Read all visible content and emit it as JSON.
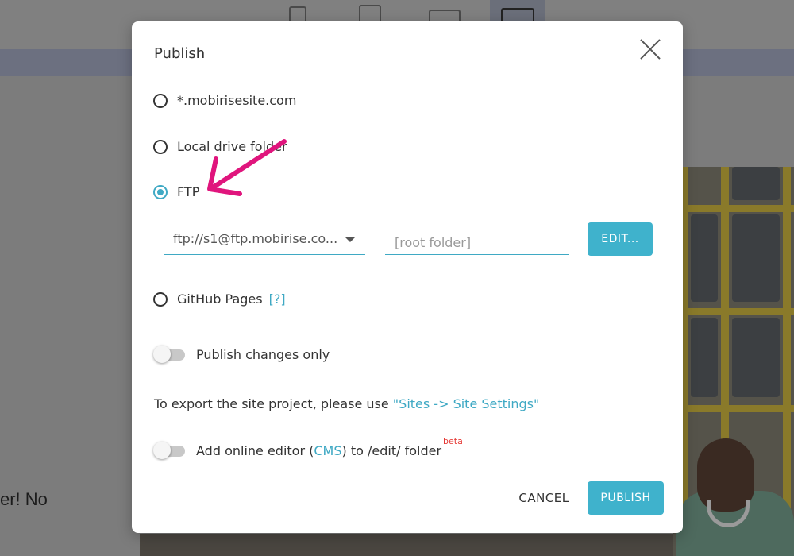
{
  "background": {
    "page_text": "er! No"
  },
  "modal": {
    "title": "Publish",
    "options": [
      {
        "label": "*.mobirisesite.com",
        "selected": false
      },
      {
        "label": "Local drive folder",
        "selected": false
      },
      {
        "label": "FTP",
        "selected": true
      },
      {
        "label": "GitHub Pages",
        "selected": false
      }
    ],
    "ftp": {
      "server_value": "ftp://s1@ftp.mobirise.co...",
      "root_placeholder": "[root folder]",
      "edit_label": "EDIT..."
    },
    "github_help": "[?]",
    "publish_changes_only": {
      "label": "Publish changes only",
      "on": false
    },
    "export_note": {
      "text": "To export the site project, please use ",
      "link": "\"Sites -> Site Settings\""
    },
    "cms": {
      "prefix": "Add online editor (",
      "link": "CMS",
      "suffix": ") to /edit/ folder",
      "badge": "beta",
      "on": false
    },
    "cancel_label": "CANCEL",
    "publish_label": "PUBLISH"
  },
  "colors": {
    "accent": "#3fb2cc",
    "annotation_arrow": "#e0157d",
    "beta_badge": "#e53935"
  },
  "icons": {
    "close": "close-icon",
    "dropdown": "chevron-down-icon",
    "annotation": "arrow-annotation-icon"
  }
}
